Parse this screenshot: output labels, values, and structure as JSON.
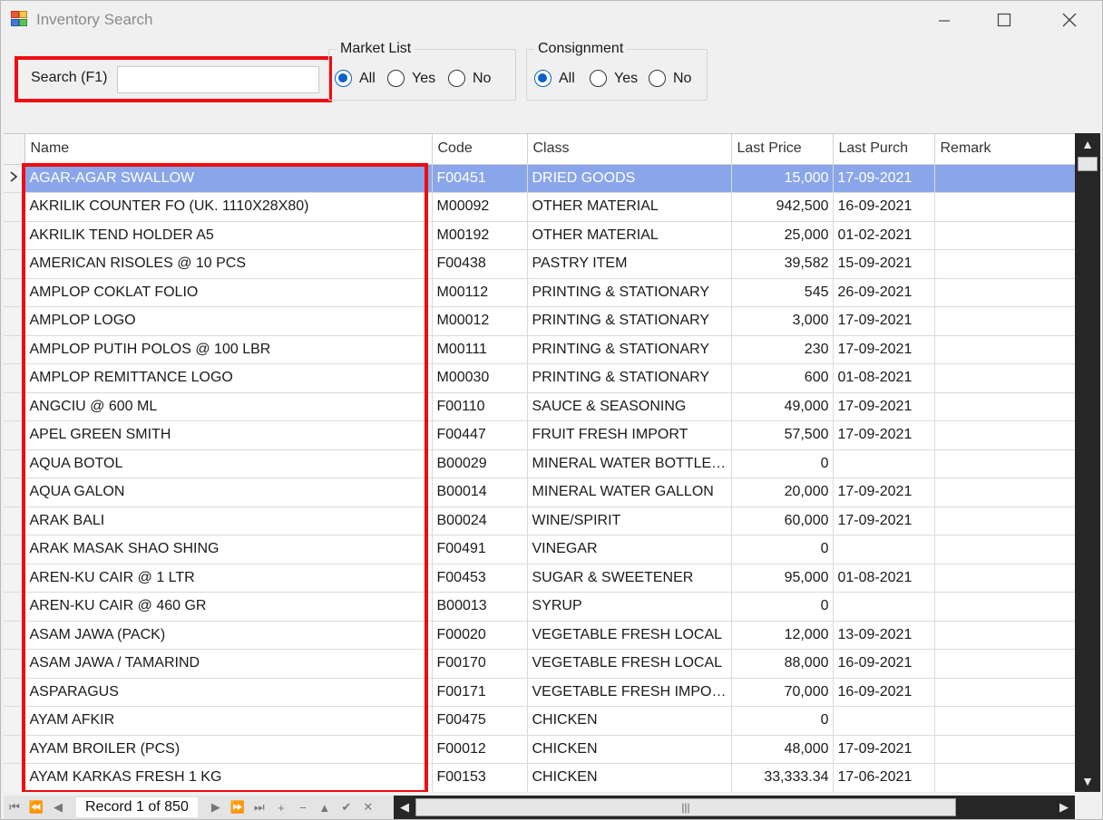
{
  "window": {
    "title": "Inventory Search"
  },
  "search": {
    "label": "Search (F1)",
    "value": "",
    "placeholder": ""
  },
  "market_list": {
    "title": "Market List",
    "options": [
      "All",
      "Yes",
      "No"
    ],
    "selected": "All"
  },
  "consignment": {
    "title": "Consignment",
    "options": [
      "All",
      "Yes",
      "No"
    ],
    "selected": "All"
  },
  "grid": {
    "columns": [
      "Name",
      "Code",
      "Class",
      "Last Price",
      "Last Purch",
      "Remark"
    ],
    "selected_row": 0,
    "rows": [
      [
        "AGAR-AGAR SWALLOW",
        "F00451",
        "DRIED GOODS",
        "15,000",
        "17-09-2021",
        ""
      ],
      [
        "AKRILIK COUNTER FO (UK. 1110X28X80)",
        "M00092",
        "OTHER MATERIAL",
        "942,500",
        "16-09-2021",
        ""
      ],
      [
        "AKRILIK TEND HOLDER A5",
        "M00192",
        "OTHER MATERIAL",
        "25,000",
        "01-02-2021",
        ""
      ],
      [
        "AMERICAN RISOLES @ 10 PCS",
        "F00438",
        "PASTRY ITEM",
        "39,582",
        "15-09-2021",
        ""
      ],
      [
        "AMPLOP COKLAT FOLIO",
        "M00112",
        "PRINTING & STATIONARY",
        "545",
        "26-09-2021",
        ""
      ],
      [
        "AMPLOP LOGO",
        "M00012",
        "PRINTING & STATIONARY",
        "3,000",
        "17-09-2021",
        ""
      ],
      [
        "AMPLOP PUTIH POLOS @ 100 LBR",
        "M00111",
        "PRINTING & STATIONARY",
        "230",
        "17-09-2021",
        ""
      ],
      [
        "AMPLOP REMITTANCE LOGO",
        "M00030",
        "PRINTING & STATIONARY",
        "600",
        "01-08-2021",
        ""
      ],
      [
        "ANGCIU @ 600  ML",
        "F00110",
        "SAUCE & SEASONING",
        "49,000",
        "17-09-2021",
        ""
      ],
      [
        "APEL GREEN SMITH",
        "F00447",
        "FRUIT FRESH IMPORT",
        "57,500",
        "17-09-2021",
        ""
      ],
      [
        "AQUA BOTOL",
        "B00029",
        "MINERAL WATER BOTTLED…",
        "0",
        "",
        ""
      ],
      [
        "AQUA GALON",
        "B00014",
        "MINERAL WATER GALLON",
        "20,000",
        "17-09-2021",
        ""
      ],
      [
        "ARAK BALI",
        "B00024",
        "WINE/SPIRIT",
        "60,000",
        "17-09-2021",
        ""
      ],
      [
        "ARAK MASAK SHAO SHING",
        "F00491",
        "VINEGAR",
        "0",
        "",
        ""
      ],
      [
        "AREN-KU CAIR @ 1 LTR",
        "F00453",
        "SUGAR & SWEETENER",
        "95,000",
        "01-08-2021",
        ""
      ],
      [
        "AREN-KU CAIR @ 460 GR",
        "B00013",
        "SYRUP",
        "0",
        "",
        ""
      ],
      [
        "ASAM JAWA (PACK)",
        "F00020",
        "VEGETABLE FRESH LOCAL",
        "12,000",
        "13-09-2021",
        ""
      ],
      [
        "ASAM JAWA / TAMARIND",
        "F00170",
        "VEGETABLE FRESH LOCAL",
        "88,000",
        "16-09-2021",
        ""
      ],
      [
        "ASPARAGUS",
        "F00171",
        "VEGETABLE FRESH IMPORT",
        "70,000",
        "16-09-2021",
        ""
      ],
      [
        "AYAM AFKIR",
        "F00475",
        "CHICKEN",
        "0",
        "",
        ""
      ],
      [
        "AYAM BROILER (PCS)",
        "F00012",
        "CHICKEN",
        "48,000",
        "17-09-2021",
        ""
      ],
      [
        "AYAM KARKAS FRESH 1 KG",
        "F00153",
        "CHICKEN",
        "33,333.34",
        "17-06-2021",
        ""
      ]
    ]
  },
  "navigator": {
    "record_text": "Record 1 of 850"
  },
  "colors": {
    "highlight": "#ee0b12",
    "selection": "#8aa6ea",
    "radio": "#0c63c5"
  }
}
